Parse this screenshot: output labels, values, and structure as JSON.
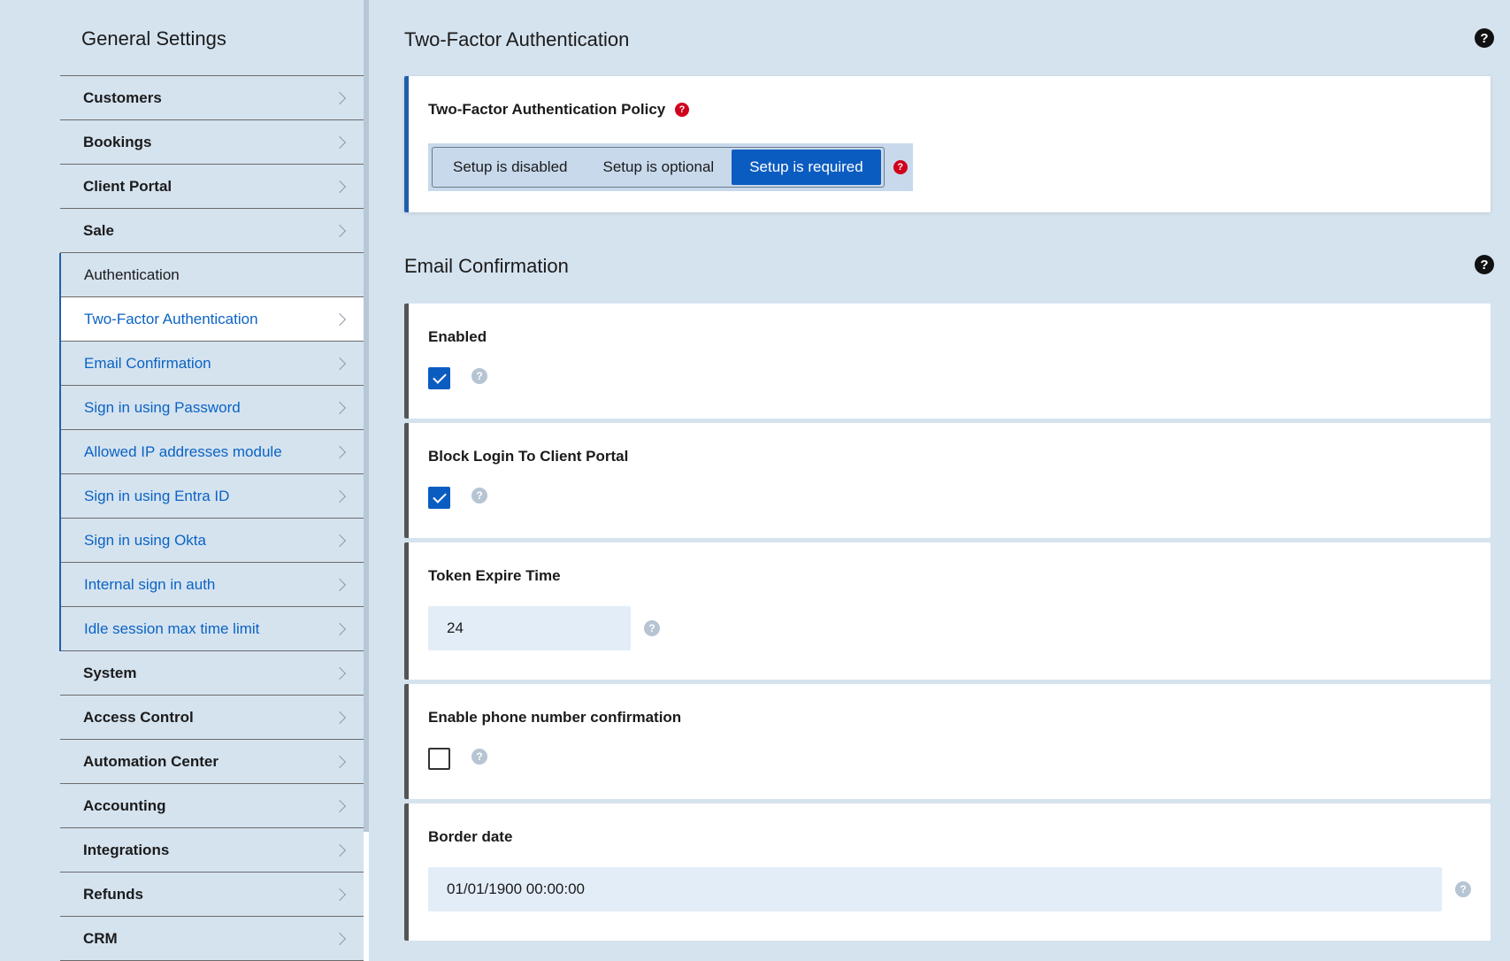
{
  "sidebar": {
    "title": "General Settings",
    "items_top": [
      {
        "label": "Customers"
      },
      {
        "label": "Bookings"
      },
      {
        "label": "Client Portal"
      },
      {
        "label": "Sale"
      }
    ],
    "group": {
      "label": "Authentication",
      "items": [
        {
          "label": "Two-Factor Authentication",
          "active": true
        },
        {
          "label": "Email Confirmation"
        },
        {
          "label": "Sign in using Password"
        },
        {
          "label": "Allowed IP addresses module"
        },
        {
          "label": "Sign in using Entra ID"
        },
        {
          "label": "Sign in using Okta"
        },
        {
          "label": "Internal sign in auth"
        },
        {
          "label": "Idle session max time limit"
        }
      ]
    },
    "items_bottom": [
      {
        "label": "System"
      },
      {
        "label": "Access Control"
      },
      {
        "label": "Automation Center"
      },
      {
        "label": "Accounting"
      },
      {
        "label": "Integrations"
      },
      {
        "label": "Refunds"
      },
      {
        "label": "CRM"
      }
    ]
  },
  "two_factor": {
    "title": "Two-Factor Authentication",
    "policy_label": "Two-Factor Authentication Policy",
    "options": [
      "Setup is disabled",
      "Setup is optional",
      "Setup is required"
    ],
    "selected": "Setup is required"
  },
  "email_confirmation": {
    "title": "Email Confirmation",
    "enabled_label": "Enabled",
    "enabled": true,
    "block_login_label": "Block Login To Client Portal",
    "block_login": true,
    "token_expire_label": "Token Expire Time",
    "token_expire_value": "24",
    "phone_confirm_label": "Enable phone number confirmation",
    "phone_confirm": false,
    "border_date_label": "Border date",
    "border_date_value": "01/01/1900 00:00:00"
  },
  "icons": {
    "help": "?",
    "chevron": "chevron-right-icon",
    "checkmark": "checkmark-icon"
  },
  "colors": {
    "accent": "#0b5cc1",
    "link": "#0b63c4",
    "background": "#d5e3ef",
    "help_red": "#d0021b"
  }
}
